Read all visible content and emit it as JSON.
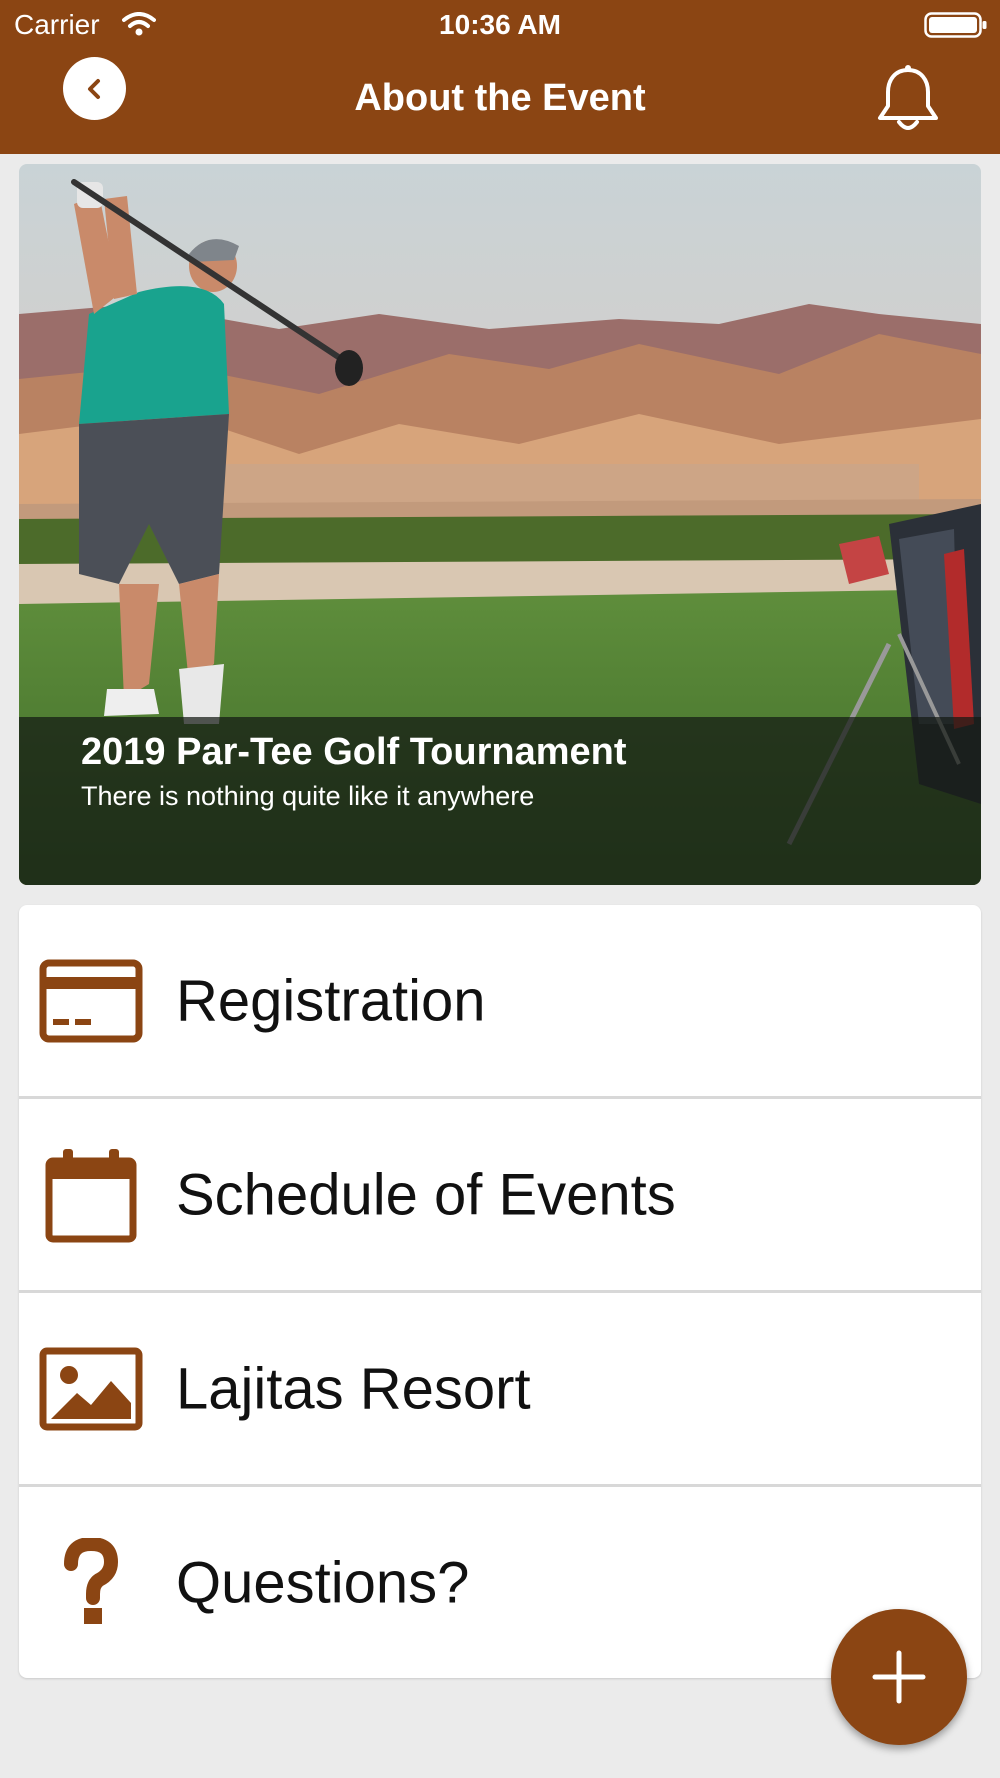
{
  "status_bar": {
    "carrier": "Carrier",
    "time": "10:36 AM"
  },
  "header": {
    "title": "About the Event"
  },
  "hero": {
    "title": "2019 Par-Tee Golf Tournament",
    "subtitle": "There is nothing quite like it anywhere"
  },
  "menu": [
    {
      "label": "Registration",
      "icon": "credit-card-icon"
    },
    {
      "label": "Schedule of Events",
      "icon": "calendar-icon"
    },
    {
      "label": "Lajitas Resort",
      "icon": "image-icon"
    },
    {
      "label": "Questions?",
      "icon": "question-mark-icon"
    }
  ],
  "colors": {
    "brand": "#8b4513",
    "background": "#ebebeb"
  }
}
